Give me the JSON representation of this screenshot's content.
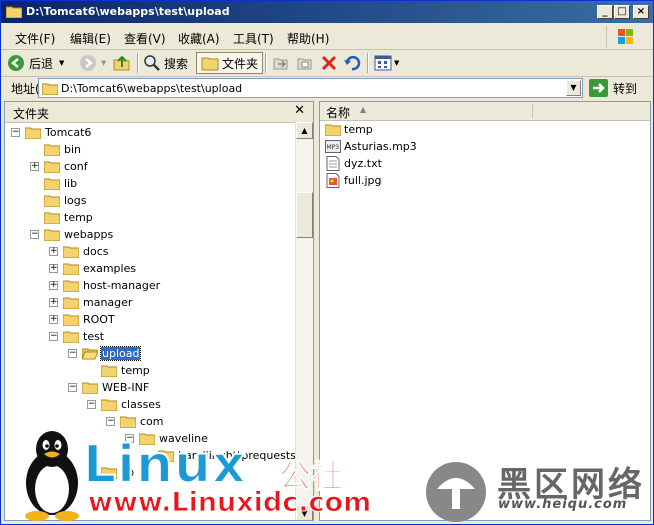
{
  "window": {
    "title": "D:\\Tomcat6\\webapps\\test\\upload"
  },
  "menu": [
    "文件(F)",
    "编辑(E)",
    "查看(V)",
    "收藏(A)",
    "工具(T)",
    "帮助(H)"
  ],
  "toolbar": {
    "back": "后退",
    "search": "搜索",
    "folders": "文件夹"
  },
  "address": {
    "label": "地址(D)",
    "value": "D:\\Tomcat6\\webapps\\test\\upload",
    "go": "转到"
  },
  "tree_pane": {
    "title": "文件夹",
    "items": [
      "Tomcat6",
      "bin",
      "conf",
      "lib",
      "logs",
      "temp",
      "webapps",
      "docs",
      "examples",
      "host-manager",
      "manager",
      "ROOT",
      "test",
      "upload",
      "temp",
      "WEB-INF",
      "classes",
      "com",
      "waveline",
      "handlinghttprequestservlet",
      "lib"
    ]
  },
  "list_pane": {
    "column_name": "名称",
    "files": [
      {
        "name": "temp",
        "icon": "folder-icon"
      },
      {
        "name": "Asturias.mp3",
        "icon": "mp3-file-icon"
      },
      {
        "name": "dyz.txt",
        "icon": "text-file-icon"
      },
      {
        "name": "full.jpg",
        "icon": "image-file-icon"
      }
    ]
  },
  "watermark": {
    "brand": "Linux",
    "brand_cn": "公社",
    "url": "www.Linuxidc.com",
    "brand2_cn": "黑区网络",
    "url2": "www.heiqu.com"
  },
  "colors": {
    "titlebar": "#0a246a",
    "selection": "#316ac5",
    "brand_blue": "#1b9ad6",
    "brand_red": "#e8161d"
  }
}
